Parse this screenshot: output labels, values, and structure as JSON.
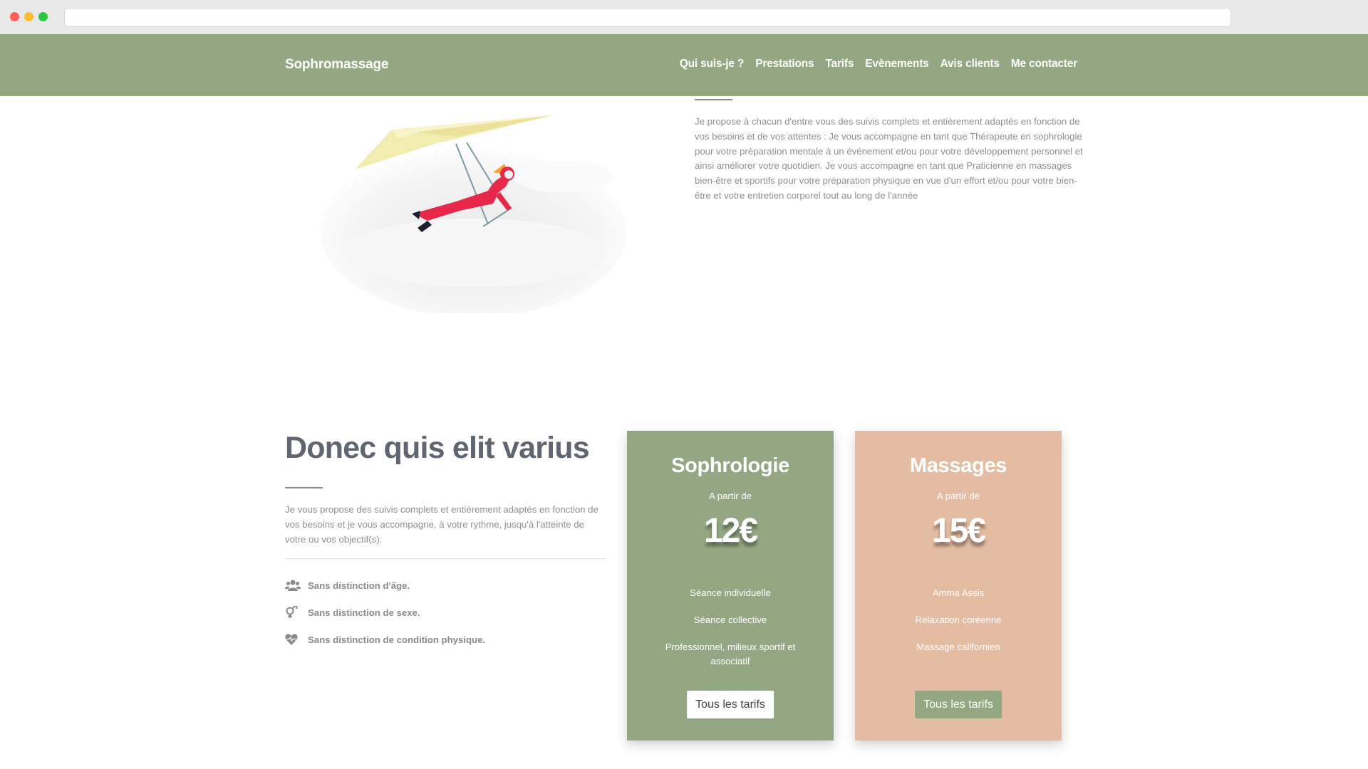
{
  "brand": "Sophromassage",
  "nav": [
    "Qui suis-je ?",
    "Prestations",
    "Tarifs",
    "Evènements",
    "Avis clients",
    "Me contacter"
  ],
  "intro": {
    "text": "Je propose à chacun d'entre vous des suivis complets et entièrement adaptés en fonction de vos besoins et de vos attentes : Je vous accompagne en tant que Thérapeute en sophrologie pour votre préparation mentale à un événement et/ou pour votre développement personnel et ainsi améliorer votre quotidien. Je vous accompagne en tant que Praticienne en massages bien-être et sportifs pour votre préparation physique en vue d'un effort et/ou pour votre bien-être et votre entretien corporel tout au long de l'année"
  },
  "section": {
    "title": "Donec quis elit varius",
    "text": "Je vous propose des suivis complets et entièrement adaptés en fonction de vos besoins et je vous accompagne, à votre rythme, jusqu'à l'atteinte de votre ou vos objectif(s).",
    "features": [
      {
        "icon": "users-icon",
        "label": "Sans distinction d'âge."
      },
      {
        "icon": "gender-icon",
        "label": "Sans distinction de sexe."
      },
      {
        "icon": "heart-icon",
        "label": "Sans distinction de condition physique."
      }
    ]
  },
  "cards": [
    {
      "title": "Sophrologie",
      "from": "A partir de",
      "price": "12€",
      "items": [
        "Séance individuelle",
        "Séance collective",
        "Professionnel, milieux sportif et associatif"
      ],
      "button": "Tous les tarifs",
      "color": "#93a783"
    },
    {
      "title": "Massages",
      "from": "A partir de",
      "price": "15€",
      "items": [
        "Amma Assis",
        "Relaxation coréenne",
        "Massage californien"
      ],
      "button": "Tous les tarifs",
      "color": "#e3bca1"
    }
  ]
}
